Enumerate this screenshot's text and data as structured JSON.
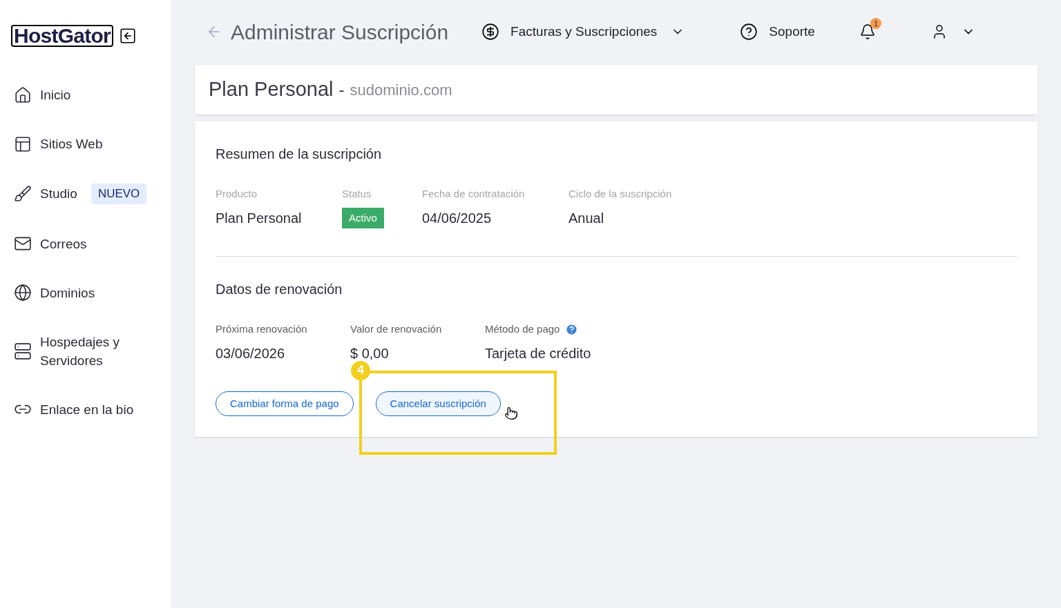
{
  "sidebar": {
    "logo": "HostGator",
    "items": [
      {
        "kind": "home",
        "label": "Inicio"
      },
      {
        "kind": "sites",
        "label": "Sitios Web"
      },
      {
        "kind": "studio",
        "label": "Studio",
        "badge": "NUEVO"
      },
      {
        "kind": "mail",
        "label": "Correos"
      },
      {
        "kind": "globe",
        "label": "Dominios"
      },
      {
        "kind": "server",
        "label": "Hospedajes y Servidores"
      },
      {
        "kind": "link",
        "label": "Enlace en la bio"
      }
    ]
  },
  "header": {
    "title": "Administrar Suscripción",
    "billing": "Facturas y Suscripciones",
    "support": "Soporte",
    "notifications": "1"
  },
  "plan": {
    "name": "Plan Personal",
    "separator": "-",
    "domain": "sudominio.com"
  },
  "summary": {
    "title": "Resumen de la suscripción",
    "fields": [
      {
        "kind": "text",
        "label": "Producto",
        "value": "Plan Personal"
      },
      {
        "kind": "status",
        "label": "Status",
        "value": "Activo"
      },
      {
        "kind": "text",
        "label": "Fecha de contratación",
        "value": "04/06/2025"
      },
      {
        "kind": "text",
        "label": "Ciclo de la suscripción",
        "value": "Anual"
      }
    ]
  },
  "renewal": {
    "title": "Datos de renovación",
    "fields": [
      {
        "label": "Próxima renovación",
        "value": "03/06/2026",
        "help": false
      },
      {
        "label": "Valor de renovación",
        "value": "$ 0,00",
        "help": false
      },
      {
        "label": "Método de pago",
        "value": "Tarjeta de crédito",
        "help": true
      }
    ],
    "buttons": [
      {
        "label": "Cambiar forma de pago",
        "hovered": false
      },
      {
        "label": "Cancelar suscripción",
        "hovered": true
      }
    ]
  },
  "annotation": {
    "number": "4"
  }
}
